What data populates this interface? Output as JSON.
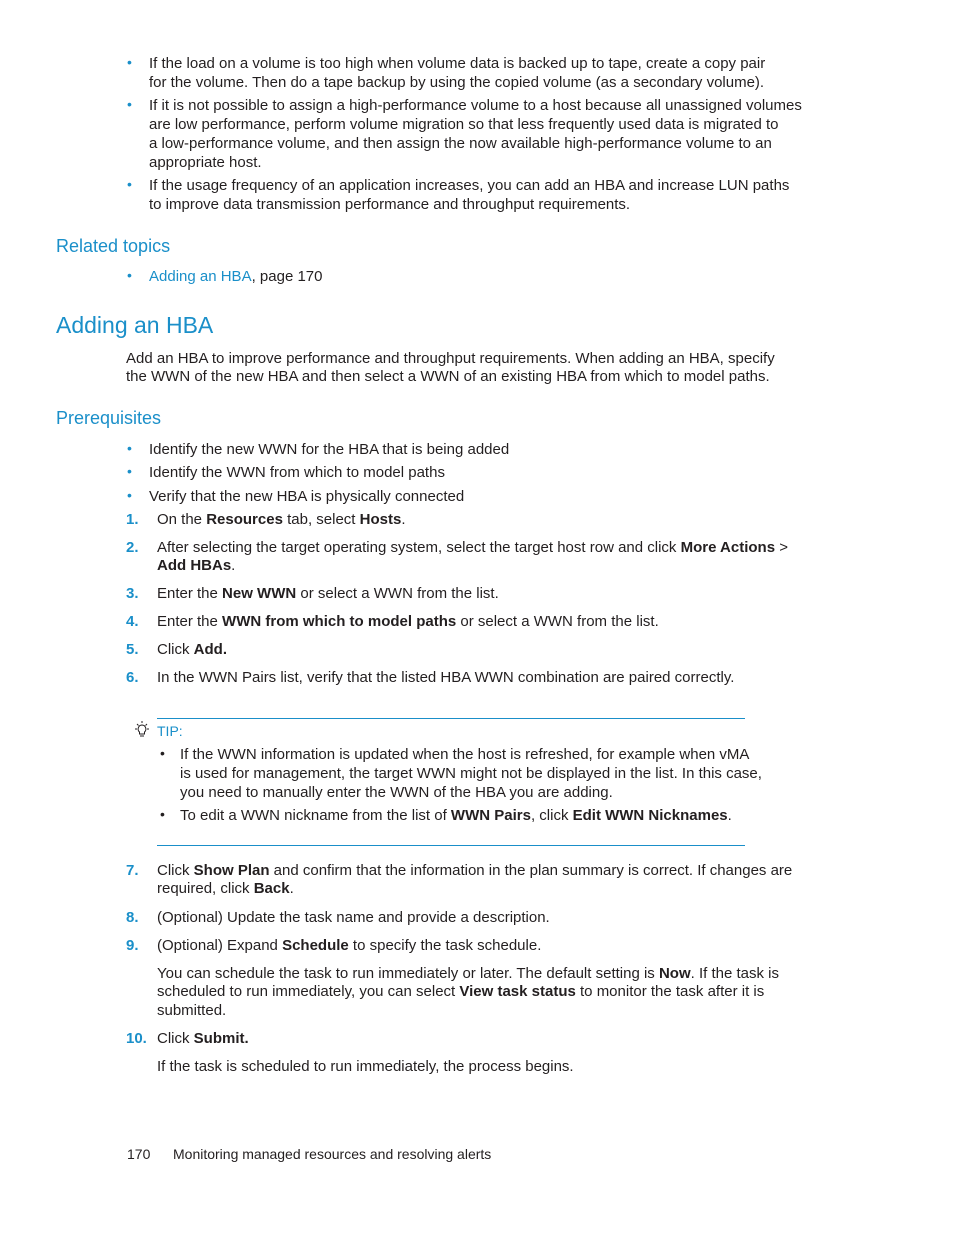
{
  "intro_bullets": [
    [
      "If the load on a volume is too high when volume data is backed up to tape, create a copy pair",
      "for the volume. Then do a tape backup by using the copied volume (as a secondary volume)."
    ],
    [
      "If it is not possible to assign a high-performance volume to a host because all unassigned volumes",
      "are low performance, perform volume migration so that less frequently used data is migrated to",
      "a low-performance volume, and then assign the now available high-performance volume to an",
      "appropriate host."
    ],
    [
      "If the usage frequency of an application increases, you can add an HBA and increase LUN paths",
      "to improve data transmission performance and throughput requirements."
    ]
  ],
  "related": {
    "heading": "Related topics",
    "link": "Adding an HBA",
    "suffix": ", page 170"
  },
  "section": {
    "title": "Adding an HBA",
    "intro": [
      "Add an HBA to improve performance and throughput requirements. When adding an HBA, specify",
      "the WWN of the new HBA and then select a WWN of an existing HBA from which to model paths."
    ]
  },
  "prereq": {
    "heading": "Prerequisites",
    "items": [
      "Identify the new WWN for the HBA that is being added",
      "Identify the WWN from which to model paths",
      "Verify that the new HBA is physically connected"
    ]
  },
  "steps": {
    "s1": {
      "num": "1.",
      "a": "On the ",
      "b1": "Resources",
      "c": " tab, select ",
      "b2": "Hosts",
      "d": "."
    },
    "s2": {
      "num": "2.",
      "a": "After selecting the target operating system, select the target host row and click ",
      "b1": "More Actions",
      "c": " >",
      "b2": "Add HBAs",
      "d": "."
    },
    "s3": {
      "num": "3.",
      "a": "Enter the ",
      "b1": "New WWN",
      "c": " or select a WWN from the list."
    },
    "s4": {
      "num": "4.",
      "a": "Enter the ",
      "b1": "WWN from which to model paths",
      "c": " or select a WWN from the list."
    },
    "s5": {
      "num": "5.",
      "a": "Click ",
      "b1": "Add."
    },
    "s6": {
      "num": "6.",
      "a": "In the WWN Pairs list, verify that the listed HBA WWN combination are paired correctly."
    },
    "s7": {
      "num": "7.",
      "a": "Click ",
      "b1": "Show Plan",
      "c": " and confirm that the information in the plan summary is correct. If changes are",
      "d": "required, click ",
      "b2": "Back",
      "e": "."
    },
    "s8": {
      "num": "8.",
      "a": "(Optional) Update the task name and provide a description."
    },
    "s9": {
      "num": "9.",
      "a": "(Optional) Expand ",
      "b1": "Schedule",
      "c": " to specify the task schedule."
    },
    "s9_note": {
      "a": "You can schedule the task to run immediately or later. The default setting is ",
      "b1": "Now",
      "c": ". If the task is",
      "d": "scheduled to run immediately, you can select ",
      "b2": "View task status",
      "e": " to monitor the task after it is",
      "f": "submitted."
    },
    "s10": {
      "num": "10.",
      "a": "Click ",
      "b1": "Submit."
    },
    "s10_note": "If the task is scheduled to run immediately, the process begins."
  },
  "tip": {
    "label": "TIP:",
    "item1": [
      "If the WWN information is updated when the host is refreshed, for example when vMA",
      "is used for management, the target WWN might not be displayed in the list. In this case,",
      "you need to manually enter the WWN of the HBA you are adding."
    ],
    "item2": {
      "a": "To edit a WWN nickname from the list of ",
      "b1": "WWN Pairs",
      "c": ", click ",
      "b2": "Edit WWN Nicknames",
      "d": "."
    }
  },
  "footer": {
    "page_number": "170",
    "chapter": "Monitoring managed resources and resolving alerts"
  },
  "colors": {
    "accent": "#1a8fc9",
    "text": "#231f20"
  }
}
